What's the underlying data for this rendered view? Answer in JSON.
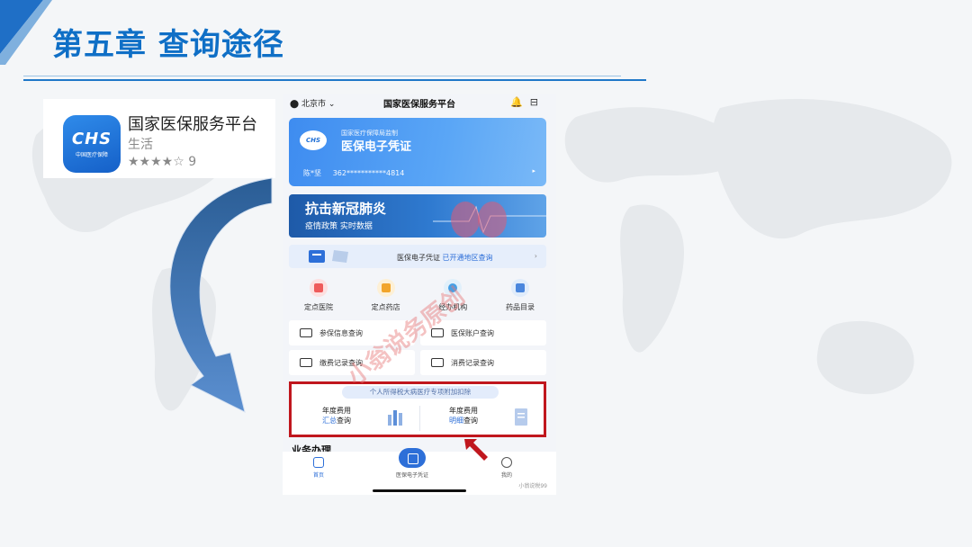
{
  "slide": {
    "title": "第五章 查询途径",
    "accent_color": "#0f6fc6"
  },
  "app_store": {
    "icon_logo": "CHS",
    "icon_sub": "中国医疗保障",
    "name": "国家医保服务平台",
    "category": "生活",
    "rating": "★★★★☆ 9",
    "rating_value": 4
  },
  "phone": {
    "location": "北京市",
    "title": "国家医保服务平台",
    "card": {
      "badge": "CHS",
      "supervisor": "国家医疗保障局监制",
      "name": "医保电子凭证",
      "holder": "陈*坚",
      "number": "362***********4814",
      "arrow": "▸"
    },
    "banner": {
      "title": "抗击新冠肺炎",
      "subtitle": "疫情政策  实时数据"
    },
    "notice": {
      "prefix": "医保电子凭证",
      "link": "已开通地区查询",
      "arrow": "›"
    },
    "quick_links": [
      {
        "label": "定点医院"
      },
      {
        "label": "定点药店"
      },
      {
        "label": "经办机构"
      },
      {
        "label": "药品目录"
      }
    ],
    "services": [
      {
        "label": "参保信息查询"
      },
      {
        "label": "医保账户查询"
      },
      {
        "label": "缴费记录查询"
      },
      {
        "label": "消费记录查询"
      }
    ],
    "tax": {
      "tag": "个人所得税大病医疗专项附加扣除",
      "left_line1": "年度费用",
      "left_hl": "汇总",
      "left_rest": "查询",
      "right_line1": "年度费用",
      "right_hl": "明细",
      "right_rest": "查询"
    },
    "section_title": "业务办理",
    "tabs": {
      "home": "首页",
      "center": "医保电子凭证",
      "mine": "我的"
    },
    "footer_mark": "小翁说税99",
    "watermark": "小翁说务原创"
  }
}
